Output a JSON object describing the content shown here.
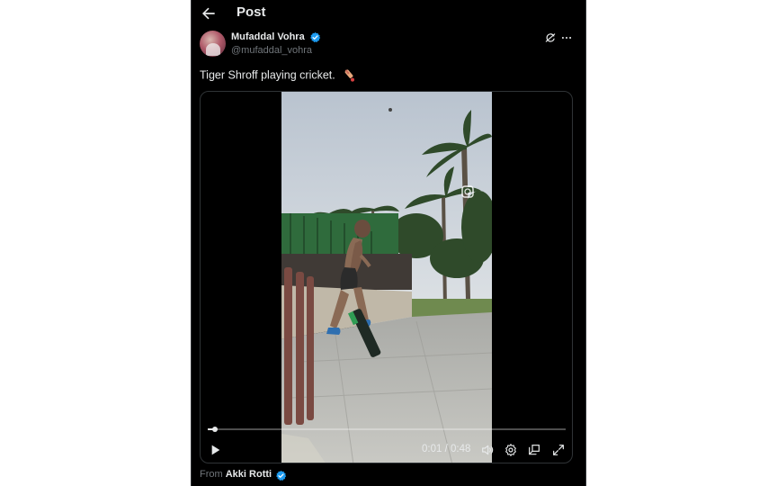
{
  "header": {
    "title": "Post",
    "back_icon": "arrow-left-icon"
  },
  "author": {
    "name": "Mufaddal Vohra",
    "handle": "@mufaddal_vohra",
    "verified": true
  },
  "post": {
    "text": "Tiger Shroff playing cricket.",
    "emoji": "cricket-bat-icon"
  },
  "video": {
    "current_time": "0:01",
    "separator": "/",
    "duration": "0:48",
    "progress_fraction": 0.021,
    "controls": [
      "play-icon",
      "volume-icon",
      "settings-icon",
      "pip-icon",
      "fullscreen-icon"
    ]
  },
  "source": {
    "prefix": "From",
    "name": "Akki Rotti",
    "verified": true
  },
  "colors": {
    "background": "#000000",
    "text": "#e7e9ea",
    "muted": "#71767b",
    "verified": "#1d9bf0",
    "page": "#ffffff"
  }
}
